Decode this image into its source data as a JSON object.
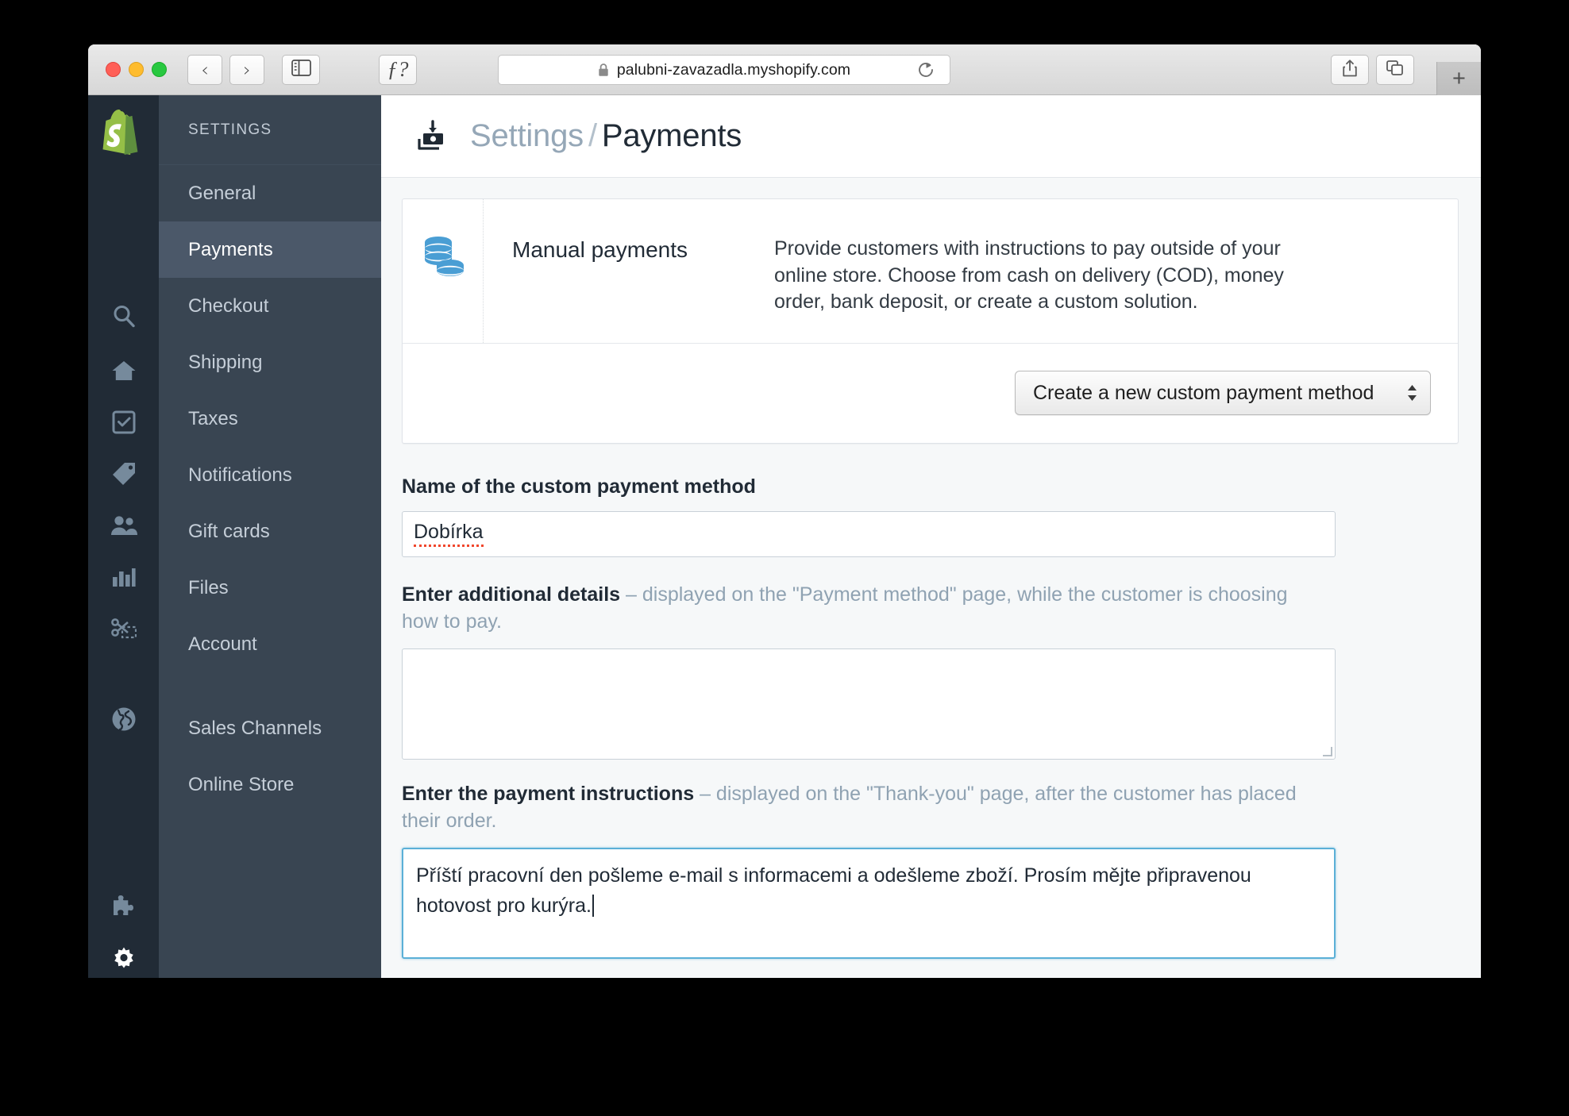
{
  "browser": {
    "url": "palubni-zavazadla.myshopify.com",
    "back_label": "‹",
    "forward_label": "›",
    "reader_label": "ƒ?",
    "newtab_label": "+",
    "icons": {
      "lock": "lock-icon",
      "sidebar": "sidebar-toggle-icon",
      "reload": "reload-icon",
      "share": "share-icon",
      "tabs": "tab-overview-icon"
    }
  },
  "rail": {
    "logo": "shopify-logo",
    "items": [
      {
        "name": "search-icon"
      },
      {
        "name": "home-icon"
      },
      {
        "name": "orders-icon"
      },
      {
        "name": "products-icon"
      },
      {
        "name": "customers-icon"
      },
      {
        "name": "analytics-icon"
      },
      {
        "name": "discounts-icon"
      },
      {
        "name": "online-store-icon"
      },
      {
        "name": "apps-icon"
      },
      {
        "name": "settings-icon"
      },
      {
        "name": "user-avatar"
      }
    ]
  },
  "sidebar": {
    "heading": "SETTINGS",
    "items": [
      {
        "label": "General",
        "active": false
      },
      {
        "label": "Payments",
        "active": true
      },
      {
        "label": "Checkout",
        "active": false
      },
      {
        "label": "Shipping",
        "active": false
      },
      {
        "label": "Taxes",
        "active": false
      },
      {
        "label": "Notifications",
        "active": false
      },
      {
        "label": "Gift cards",
        "active": false
      },
      {
        "label": "Files",
        "active": false
      },
      {
        "label": "Account",
        "active": false
      }
    ],
    "items_secondary": [
      {
        "label": "Sales Channels",
        "active": false
      },
      {
        "label": "Online Store",
        "active": false
      }
    ]
  },
  "header": {
    "parent": "Settings",
    "separator": "/",
    "current": "Payments"
  },
  "manual_payments": {
    "title": "Manual payments",
    "description": "Provide customers with instructions to pay outside of your online store. Choose from cash on delivery (COD), money order, bank deposit, or create a custom solution.",
    "select_value": "Create a new custom payment method"
  },
  "form": {
    "name_label": "Name of the custom payment method",
    "name_value": "Dobírka",
    "details_label_bold": "Enter additional details",
    "details_label_hint": " – displayed on the \"Payment method\" page, while the customer is choosing how to pay.",
    "details_value": "",
    "instructions_label_bold": "Enter the payment instructions",
    "instructions_label_hint": " – displayed on the \"Thank-you\" page, after the customer has placed their order.",
    "instructions_value": "Příští pracovní den pošleme e-mail s informacemi a odešleme zboží. Prosím mějte připravenou hotovost pro kurýra."
  },
  "colors": {
    "rail_bg": "#212b36",
    "sidebar_bg": "#394552",
    "sidebar_active": "#4b5869",
    "accent_blue": "#5bb0d7",
    "shopify_green": "#96bf48"
  }
}
